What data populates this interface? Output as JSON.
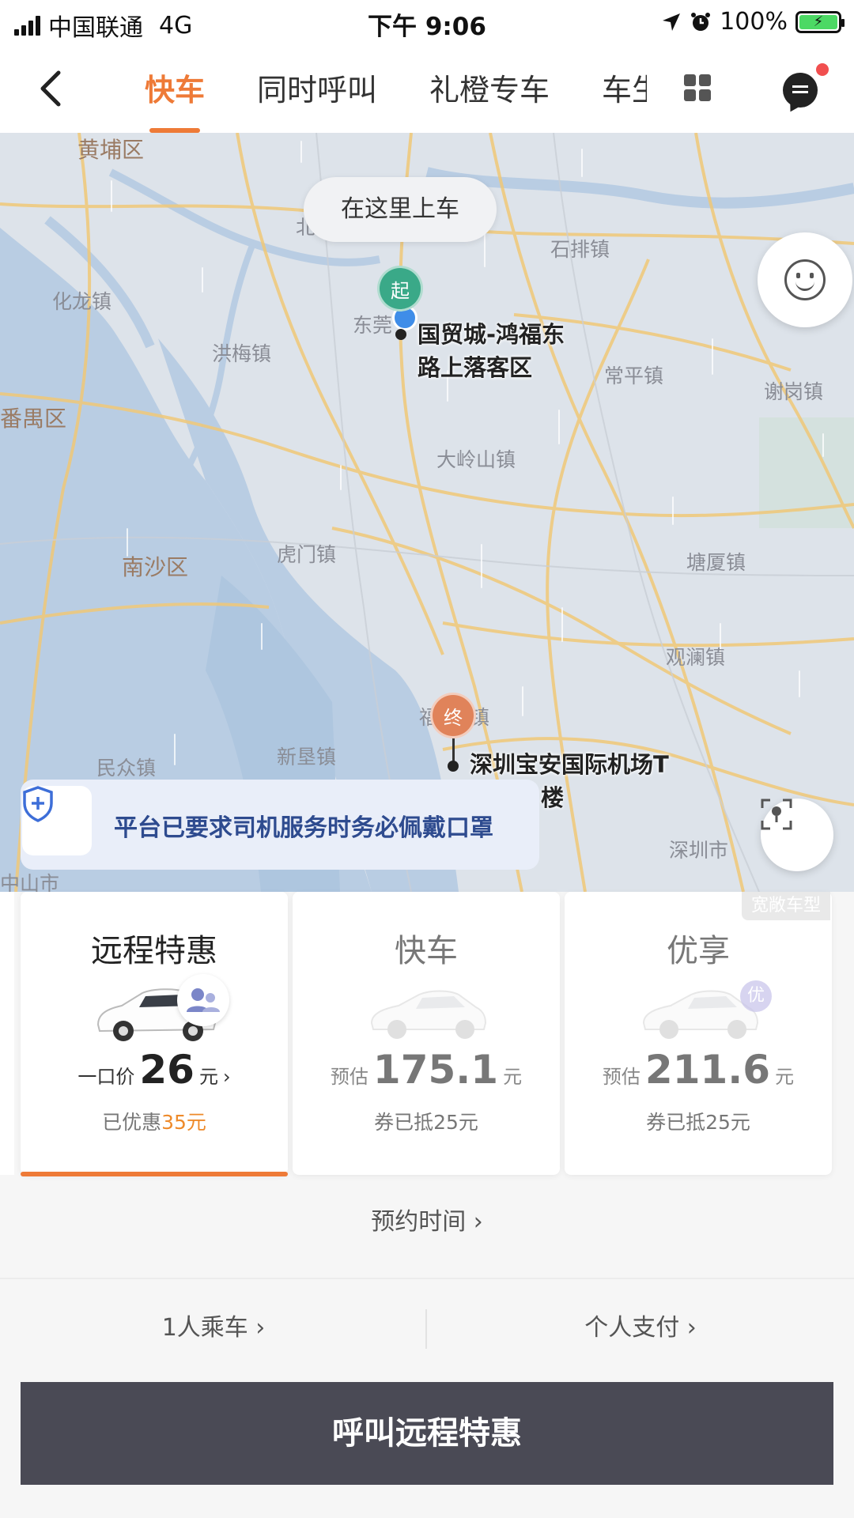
{
  "status_bar": {
    "carrier": "中国联通",
    "network": "4G",
    "time": "下午 9:06",
    "battery": "100%"
  },
  "nav": {
    "tabs": [
      {
        "label": "快车",
        "active": true
      },
      {
        "label": "同时呼叫",
        "active": false
      },
      {
        "label": "礼橙专车",
        "active": false
      },
      {
        "label": "车生",
        "active": false
      }
    ],
    "accent_color": "#ee7a37"
  },
  "map": {
    "pickup_bubble": "在这里上车",
    "start_marker": "起",
    "end_marker": "终",
    "pickup_label_line1": "国贸城-鸿福东",
    "pickup_label_line2": "路上落客区",
    "dropoff_label_line1": "深圳宝安国际机场T",
    "dropoff_label_line2": "楼",
    "places": {
      "huangpu": "黄埔区",
      "shipai": "石排镇",
      "hualong": "化龙镇",
      "dongguan": "东莞",
      "hongmei": "洪梅镇",
      "changping": "常平镇",
      "xiegang": "谢岗镇",
      "panyu": "番禺区",
      "dalingshan": "大岭山镇",
      "nansha": "南沙区",
      "humen": "虎门镇",
      "tangxia": "塘厦镇",
      "guanlan": "观澜镇",
      "fuyong": "福",
      "fuyong_suffix": "镇",
      "minzhong": "民众镇",
      "xinken": "新垦镇",
      "zhongshan": "中山市",
      "shenzhen": "深圳市",
      "bei": "北"
    },
    "notice": "平台已要求司机服务时务必佩戴口罩"
  },
  "cards": {
    "wide_tag": "宽敞车型",
    "items": [
      {
        "name": "远程特惠",
        "prefix": "一口价",
        "price": "26",
        "unit": "元",
        "arrow": "›",
        "discount_label": "已优惠",
        "discount_amount": "35元"
      },
      {
        "name": "快车",
        "prefix": "预估",
        "price": "175.1",
        "unit": "元",
        "discount_label": "券已抵25元"
      },
      {
        "name": "优享",
        "prefix": "预估",
        "price": "211.6",
        "unit": "元",
        "discount_label": "券已抵25元",
        "badge": "优"
      }
    ]
  },
  "controls": {
    "schedule": "预约时间 ›",
    "passengers": "1人乘车 ›",
    "payment": "个人支付 ›",
    "call_button": "呼叫远程特惠"
  }
}
